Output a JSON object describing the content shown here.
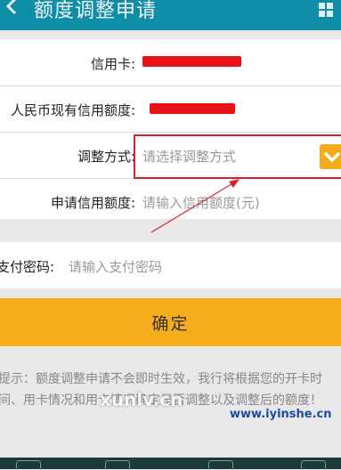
{
  "header": {
    "title": "额度调整申请",
    "back_icon": "chevron-left-icon",
    "menu_icon": "grid-icon"
  },
  "form": {
    "credit_card": {
      "label": "信用卡:"
    },
    "rmb_limit": {
      "label": "人民币现有信用额度:"
    },
    "adjust_method": {
      "label": "调整方式:",
      "placeholder": "请选择调整方式"
    },
    "apply_limit": {
      "label": "申请信用额度:",
      "placeholder": "请输入信用额度(元)"
    },
    "pay_password": {
      "label": "支付密码:",
      "placeholder": "请输入支付密码"
    }
  },
  "confirm_label": "确定",
  "tip_text": "提示：额度调整申请不会即时生效，我行将根据您的开卡时间、用卡情况和用卡情况确定是否调整以及调整后的额度！",
  "watermarks": {
    "left": "xunlv.cn",
    "right": "www.iyinshe.cn"
  },
  "colors": {
    "header": "#0e8ea7",
    "accent": "#f5ad1c",
    "highlight": "#d8222a",
    "redaction": "#e8131a"
  }
}
